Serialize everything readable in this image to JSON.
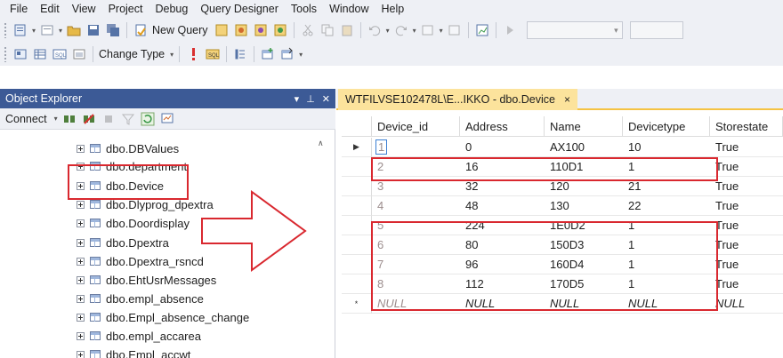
{
  "menu": [
    "File",
    "Edit",
    "View",
    "Project",
    "Debug",
    "Query Designer",
    "Tools",
    "Window",
    "Help"
  ],
  "toolbar": {
    "new_query_label": "New Query",
    "change_type_label": "Change Type"
  },
  "object_explorer": {
    "title": "Object Explorer",
    "pin_label": "▾ p ×",
    "connect_label": "Connect",
    "items": [
      "dbo.DBValues",
      "dbo.department",
      "dbo.Device",
      "dbo.Dlyprog_dpextra",
      "dbo.Doordisplay",
      "dbo.Dpextra",
      "dbo.Dpextra_rsncd",
      "dbo.EhtUsrMessages",
      "dbo.empl_absence",
      "dbo.Empl_absence_change",
      "dbo.empl_accarea",
      "dbo.Empl_accwt"
    ]
  },
  "document_tab": {
    "title": "WTFILVSE102478L\\E...IKKO - dbo.Device",
    "close": "×"
  },
  "grid": {
    "columns": [
      "Device_id",
      "Address",
      "Name",
      "Devicetype",
      "Storestate"
    ],
    "rows": [
      [
        "1",
        "0",
        "AX100",
        "10",
        "True"
      ],
      [
        "2",
        "16",
        "110D1",
        "1",
        "True"
      ],
      [
        "3",
        "32",
        "120",
        "21",
        "True"
      ],
      [
        "4",
        "48",
        "130",
        "22",
        "True"
      ],
      [
        "5",
        "224",
        "1E0D2",
        "1",
        "True"
      ],
      [
        "6",
        "80",
        "150D3",
        "1",
        "True"
      ],
      [
        "7",
        "96",
        "160D4",
        "1",
        "True"
      ],
      [
        "8",
        "112",
        "170D5",
        "1",
        "True"
      ],
      [
        "NULL",
        "NULL",
        "NULL",
        "NULL",
        "NULL"
      ]
    ],
    "row_markers": [
      "▶",
      "",
      "",
      "",
      "",
      "",
      "",
      "",
      "*"
    ]
  },
  "colors": {
    "accent": "#3c5a96",
    "tab_active": "#fce39c",
    "annotation": "#d9282f"
  }
}
